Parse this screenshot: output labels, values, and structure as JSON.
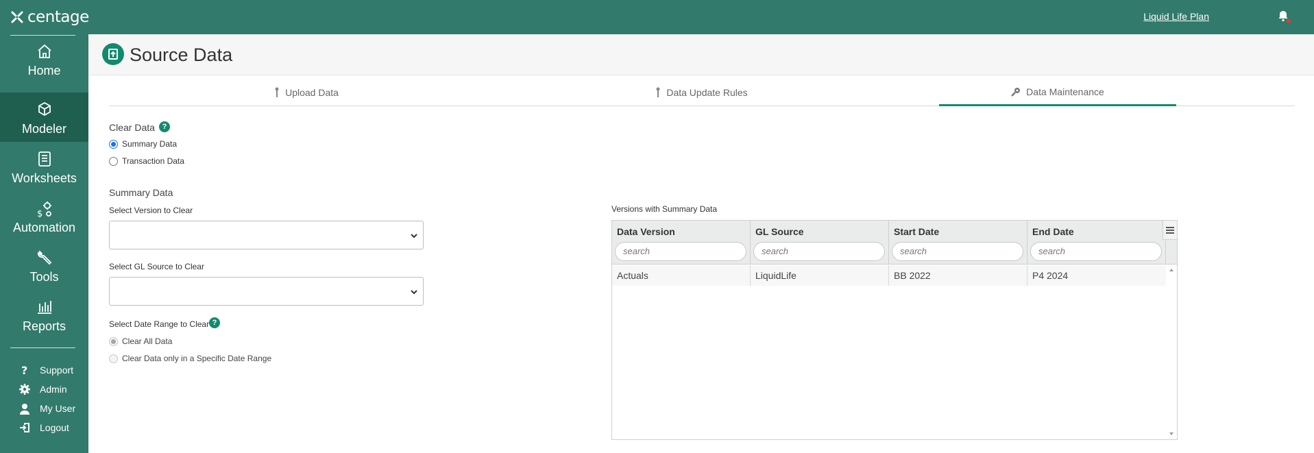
{
  "brand": {
    "name": "centage"
  },
  "topbar": {
    "plan_link": "Liquid Life Plan",
    "bell_icon": "bell-icon"
  },
  "sidebar": {
    "nav": [
      {
        "label": "Home",
        "icon": "home-icon"
      },
      {
        "label": "Modeler",
        "icon": "modeler-icon",
        "active": true
      },
      {
        "label": "Worksheets",
        "icon": "worksheets-icon"
      },
      {
        "label": "Automation",
        "icon": "automation-icon"
      },
      {
        "label": "Tools",
        "icon": "tools-icon"
      },
      {
        "label": "Reports",
        "icon": "reports-icon"
      }
    ],
    "utility": [
      {
        "label": "Support",
        "icon": "question-icon"
      },
      {
        "label": "Admin",
        "icon": "gear-icon"
      },
      {
        "label": "My User",
        "icon": "user-icon"
      },
      {
        "label": "Logout",
        "icon": "logout-icon"
      }
    ]
  },
  "page": {
    "title": "Source Data",
    "icon": "upload-icon"
  },
  "tabs": [
    {
      "label": "Upload Data",
      "icon": "pin-icon"
    },
    {
      "label": "Data Update Rules",
      "icon": "pin-icon"
    },
    {
      "label": "Data Maintenance",
      "icon": "wrench-icon",
      "active": true
    }
  ],
  "clear_data": {
    "title": "Clear Data",
    "help": "?",
    "options": [
      {
        "label": "Summary Data",
        "checked": true
      },
      {
        "label": "Transaction Data",
        "checked": false
      }
    ]
  },
  "summary": {
    "title": "Summary Data",
    "version_label": "Select Version to Clear",
    "version_value": "",
    "gl_label": "Select GL Source to Clear",
    "gl_value": "",
    "date_label": "Select Date Range to Clear",
    "date_help": "?",
    "date_options": [
      {
        "label": "Clear All Data",
        "checked": true,
        "disabled": true
      },
      {
        "label": "Clear Data only in a Specific Date Range",
        "checked": false,
        "disabled": true
      }
    ]
  },
  "grid": {
    "caption": "Versions with Summary Data",
    "columns": [
      "Data Version",
      "GL Source",
      "Start Date",
      "End Date"
    ],
    "search_placeholder": "search",
    "rows": [
      [
        "Actuals",
        "LiquidLife",
        "BB 2022",
        "P4 2024"
      ]
    ]
  },
  "colors": {
    "brand": "#327a6b",
    "active_nav": "#1f5f50",
    "accent": "#138a6f"
  }
}
